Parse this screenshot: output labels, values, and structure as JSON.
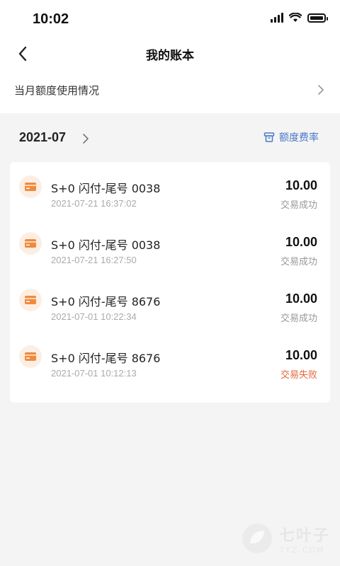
{
  "status_bar": {
    "time": "10:02"
  },
  "nav": {
    "title": "我的账本"
  },
  "quota": {
    "label": "当月额度使用情况"
  },
  "month": {
    "value": "2021-07",
    "rate_label": "额度费率"
  },
  "transactions": [
    {
      "title": "S+0 闪付-尾号 0038",
      "time": "2021-07-21 16:37:02",
      "amount": "10.00",
      "status": "交易成功"
    },
    {
      "title": "S+0 闪付-尾号 0038",
      "time": "2021-07-21 16:27:50",
      "amount": "10.00",
      "status": "交易成功"
    },
    {
      "title": "S+0 闪付-尾号 8676",
      "time": "2021-07-01 10:22:34",
      "amount": "10.00",
      "status": "交易成功"
    },
    {
      "title": "S+0 闪付-尾号 8676",
      "time": "2021-07-01 10:12:13",
      "amount": "10.00",
      "status": "交易失败"
    }
  ],
  "watermark": {
    "main": "七叶子",
    "sub": "7YZ.COM"
  },
  "colors": {
    "accent_blue": "#4a79c8",
    "card_orange": "#f08a3c",
    "fail_red": "#e8643c"
  }
}
